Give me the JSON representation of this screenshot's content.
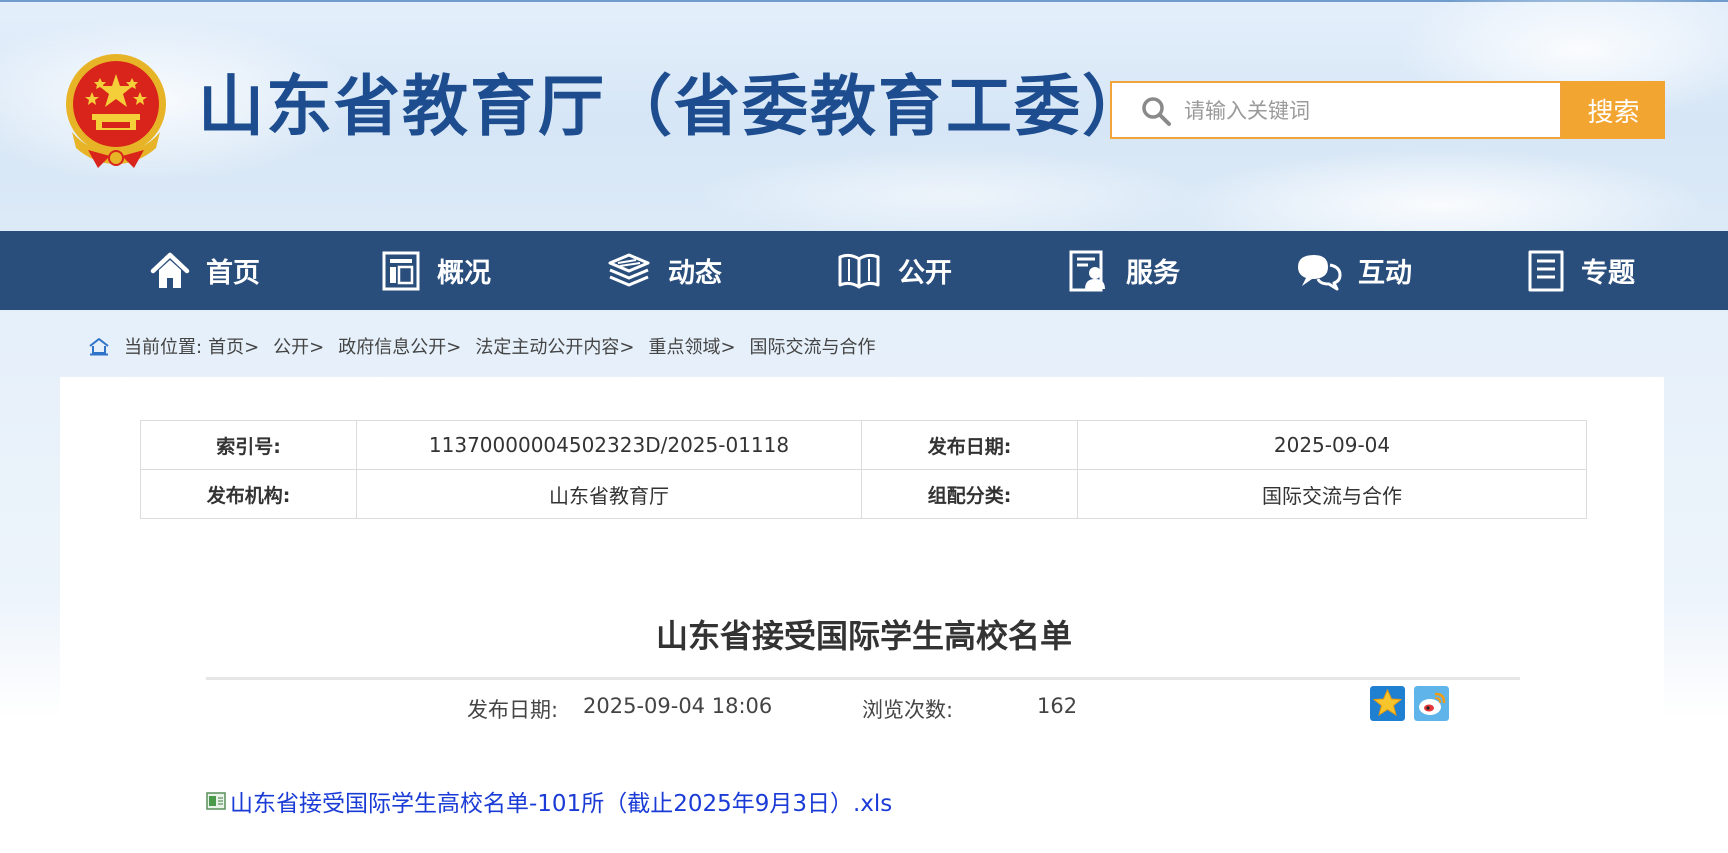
{
  "header": {
    "site_title": "山东省教育厅（省委教育工委）"
  },
  "search": {
    "placeholder": "请输入关键词",
    "button_label": "搜索"
  },
  "nav": {
    "items": [
      {
        "label": "首页",
        "icon": "home-icon"
      },
      {
        "label": "概况",
        "icon": "building-icon"
      },
      {
        "label": "动态",
        "icon": "layers-icon"
      },
      {
        "label": "公开",
        "icon": "book-icon"
      },
      {
        "label": "服务",
        "icon": "service-icon"
      },
      {
        "label": "互动",
        "icon": "chat-icon"
      },
      {
        "label": "专题",
        "icon": "document-icon"
      }
    ]
  },
  "breadcrumb": {
    "prefix": "当前位置:",
    "items": [
      "首页>",
      "公开>",
      "政府信息公开>",
      "法定主动公开内容>",
      "重点领域>",
      "国际交流与合作"
    ]
  },
  "meta_table": {
    "index_label": "索引号:",
    "index_value": "11370000004502323D/2025-01118",
    "publish_date_label": "发布日期:",
    "publish_date_value": "2025-09-04",
    "publisher_label": "发布机构:",
    "publisher_value": "山东省教育厅",
    "category_label": "组配分类:",
    "category_value": "国际交流与合作"
  },
  "article": {
    "title": "山东省接受国际学生高校名单",
    "publish_label": "发布日期:",
    "publish_datetime": "2025-09-04 18:06",
    "views_label": "浏览次数:",
    "views_count": "162",
    "attachment_label": "山东省接受国际学生高校名单-101所（截止2025年9月3日）.xls"
  },
  "colors": {
    "title_blue": "#1d4d8f",
    "nav_bg": "#2a4e7c",
    "search_orange": "#f3a531",
    "link_blue": "#1a3bd6"
  }
}
